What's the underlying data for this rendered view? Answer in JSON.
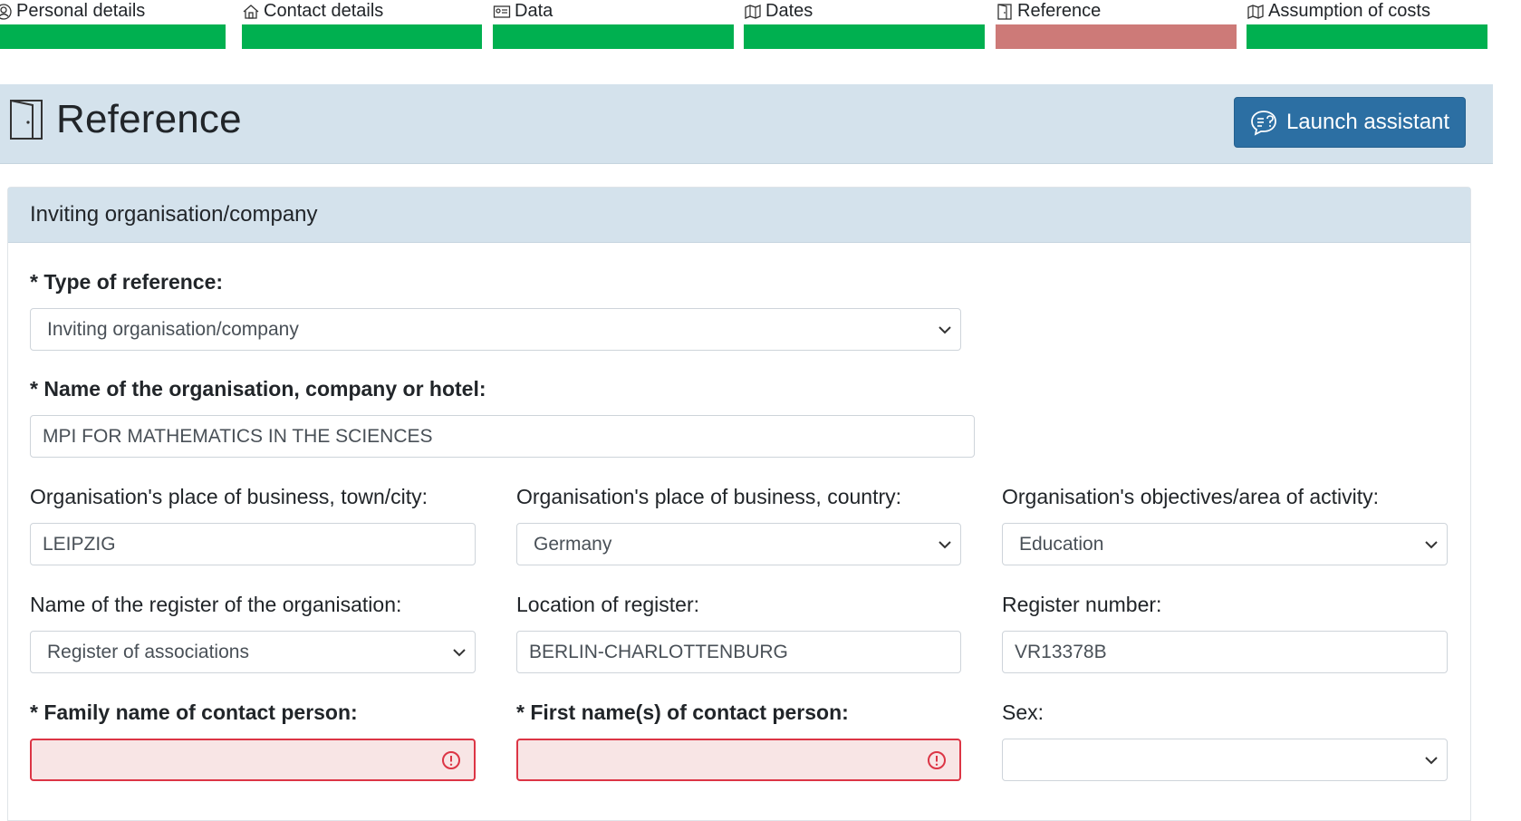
{
  "steps": [
    {
      "label": "Personal details",
      "icon": "person-circle-icon",
      "status": "complete",
      "color": "#00b050"
    },
    {
      "label": "Contact details",
      "icon": "house-icon",
      "status": "complete",
      "color": "#00b050"
    },
    {
      "label": "Data",
      "icon": "id-card-icon",
      "status": "complete",
      "color": "#00b050"
    },
    {
      "label": "Dates",
      "icon": "map-icon",
      "status": "complete",
      "color": "#00b050"
    },
    {
      "label": "Reference",
      "icon": "door-icon",
      "status": "current-error",
      "color": "#cd7a78"
    },
    {
      "label": "Assumption of costs",
      "icon": "map-icon",
      "status": "complete",
      "color": "#00b050"
    }
  ],
  "header": {
    "title": "Reference",
    "icon": "door-icon",
    "assistant_button": "Launch assistant",
    "assistant_icon": "chat-question-icon",
    "accent_color": "#2c6fa3"
  },
  "card": {
    "title": "Inviting organisation/company"
  },
  "form": {
    "type_of_reference": {
      "label": "* Type of reference:",
      "value": "Inviting organisation/company"
    },
    "org_name": {
      "label": "* Name of the organisation, company or hotel:",
      "value": "MPI FOR MATHEMATICS IN THE SCIENCES"
    },
    "org_city": {
      "label": "Organisation's place of business, town/city:",
      "value": "LEIPZIG"
    },
    "org_country": {
      "label": "Organisation's place of business, country:",
      "value": "Germany"
    },
    "org_activity": {
      "label": "Organisation's objectives/area of activity:",
      "value": "Education"
    },
    "register_name": {
      "label": "Name of the register of the organisation:",
      "value": "Register of associations"
    },
    "register_location": {
      "label": "Location of register:",
      "value": "BERLIN-CHARLOTTENBURG"
    },
    "register_number": {
      "label": "Register number:",
      "value": "VR13378B"
    },
    "contact_family_name": {
      "label": "* Family name of contact person:",
      "value": ""
    },
    "contact_first_name": {
      "label": "* First name(s) of contact person:",
      "value": ""
    },
    "sex": {
      "label": "Sex:",
      "value": ""
    }
  },
  "colors": {
    "error_border": "#dc3545",
    "error_bg": "#f8e5e5",
    "header_bg": "#d4e2ec"
  }
}
